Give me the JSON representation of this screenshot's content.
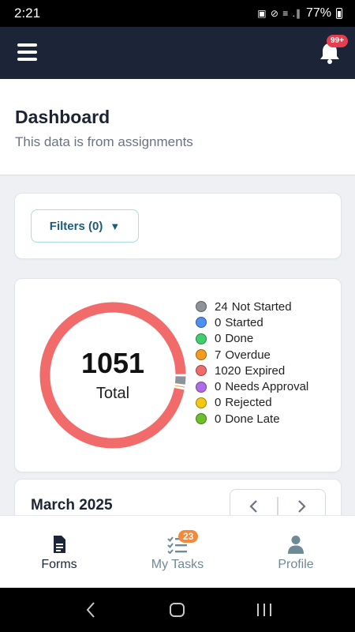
{
  "status_bar": {
    "time": "2:21",
    "battery": "77%",
    "icons": "▣ ⊘ ≡ .∥"
  },
  "app_bar": {
    "notification_badge": "99+"
  },
  "header": {
    "title": "Dashboard",
    "subtitle": "This data is from assignments"
  },
  "filters": {
    "label": "Filters (0)",
    "caret": "▼"
  },
  "summary": {
    "total": "1051",
    "total_label": "Total",
    "legend": [
      {
        "count": "24",
        "label": "Not Started",
        "color": "#8e9299"
      },
      {
        "count": "0",
        "label": "Started",
        "color": "#4f8ff2"
      },
      {
        "count": "0",
        "label": "Done",
        "color": "#3fcf6e"
      },
      {
        "count": "7",
        "label": "Overdue",
        "color": "#f59c20"
      },
      {
        "count": "1020",
        "label": "Expired",
        "color": "#f26b6b"
      },
      {
        "count": "0",
        "label": "Needs Approval",
        "color": "#b06be6"
      },
      {
        "count": "0",
        "label": "Rejected",
        "color": "#f5c70f"
      },
      {
        "count": "0",
        "label": "Done Late",
        "color": "#6bbf2a"
      }
    ]
  },
  "calendar": {
    "month": "March 2025",
    "prev_icon": "chevron-left-icon",
    "next_icon": "chevron-right-icon"
  },
  "bottom_nav": {
    "items": [
      {
        "label": "Forms",
        "icon": "document-icon"
      },
      {
        "label": "My Tasks",
        "icon": "checklist-icon",
        "badge": "23"
      },
      {
        "label": "Profile",
        "icon": "person-icon"
      }
    ]
  }
}
